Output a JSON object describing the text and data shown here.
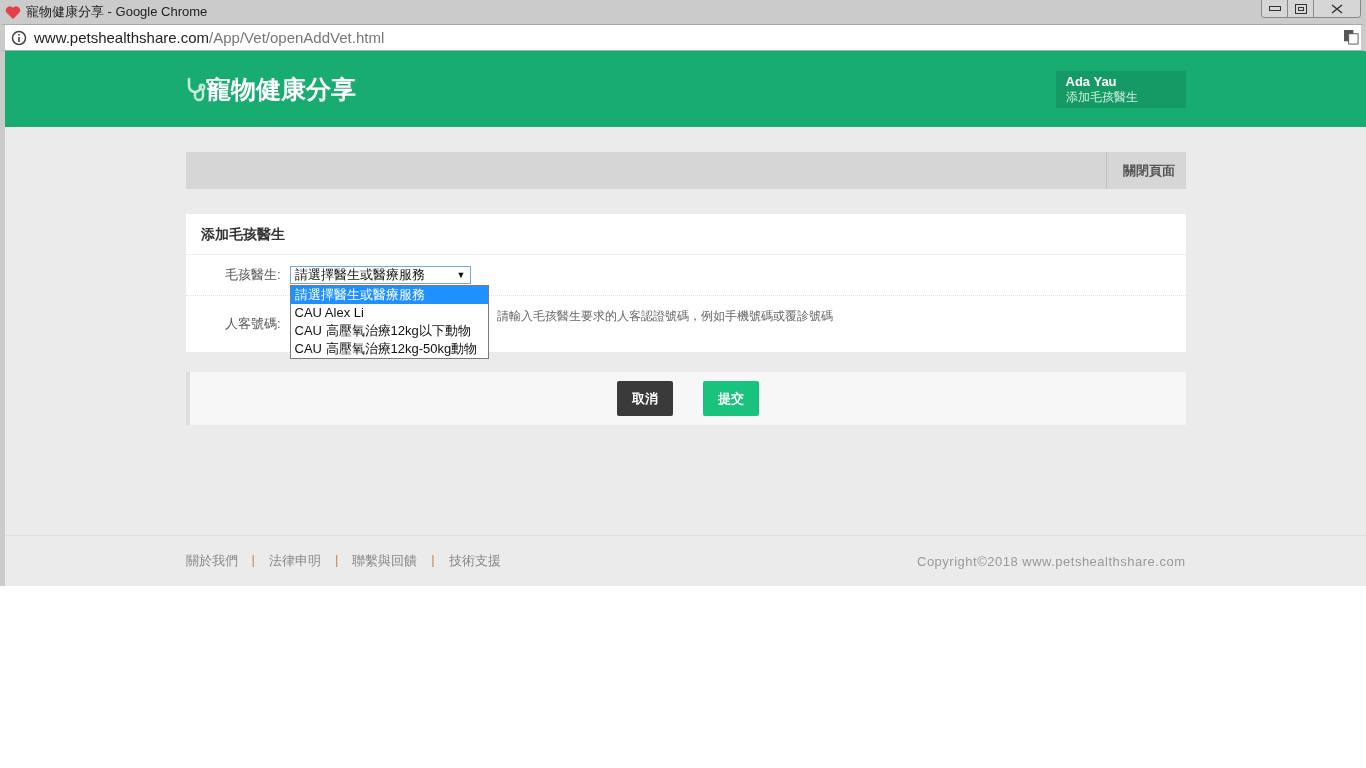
{
  "window": {
    "title": "寵物健康分享 - Google Chrome"
  },
  "address_bar": {
    "host": "www.petshealthshare.com",
    "path": "/App/Vet/openAddVet.html"
  },
  "header": {
    "logo": "寵物健康分享",
    "user": {
      "name": "Ada Yau",
      "page": "添加毛孩醫生"
    }
  },
  "toolbar": {
    "close_button": "關閉頁面"
  },
  "form": {
    "title": "添加毛孩醫生",
    "vet_field": {
      "label": "毛孩醫生:",
      "value": "請選擇醫生或醫療服務",
      "caret": "▼",
      "expanded": true,
      "options": [
        {
          "label": "請選擇醫生或醫療服務",
          "selected": true
        },
        {
          "label": "CAU Alex Li",
          "selected": false
        },
        {
          "label": "CAU 高壓氧治療12kg以下動物",
          "selected": false
        },
        {
          "label": "CAU 高壓氧治療12kg-50kg動物",
          "selected": false
        }
      ]
    },
    "customer_field": {
      "label": "人客號碼:",
      "hint": "請輸入毛孩醫生要求的人客認證號碼，例如手機號碼或覆診號碼"
    },
    "buttons": [
      {
        "label": "取消",
        "kind": "cancel"
      },
      {
        "label": "提交",
        "kind": "submit"
      }
    ]
  },
  "footer": {
    "items": [
      {
        "kind": "link",
        "label": "關於我們"
      },
      {
        "kind": "separator",
        "label": "|"
      },
      {
        "kind": "link",
        "label": "法律申明"
      },
      {
        "kind": "separator",
        "label": "|"
      },
      {
        "kind": "link",
        "label": "聯繫與回饋"
      },
      {
        "kind": "separator",
        "label": "|"
      },
      {
        "kind": "link",
        "label": "技術支援"
      }
    ],
    "copyright": "Copyright©2018 www.petshealthshare.com"
  }
}
